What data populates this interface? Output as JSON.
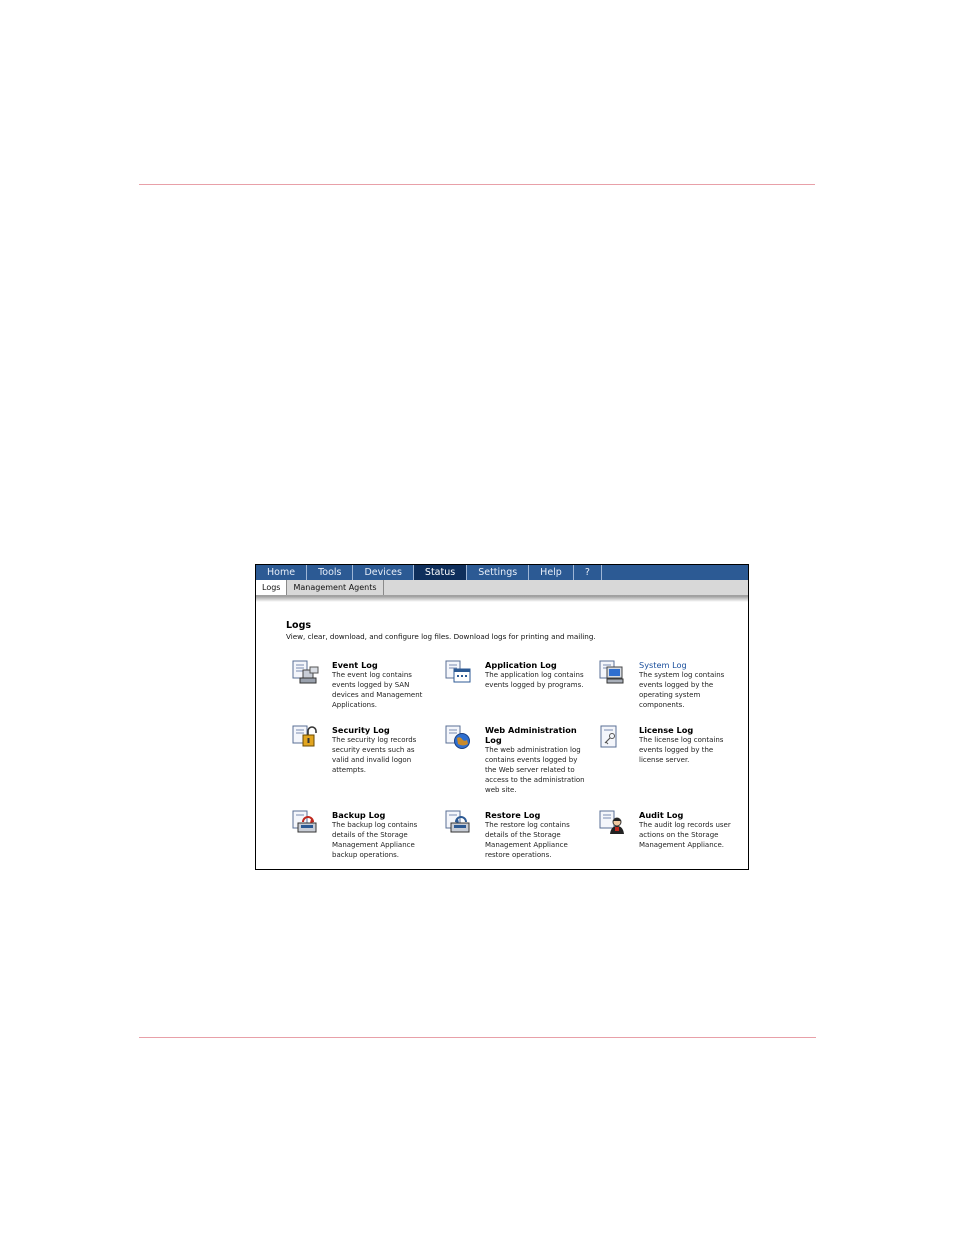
{
  "nav": {
    "tabs": [
      {
        "label": "Home"
      },
      {
        "label": "Tools"
      },
      {
        "label": "Devices"
      },
      {
        "label": "Status"
      },
      {
        "label": "Settings"
      },
      {
        "label": "Help"
      },
      {
        "label": "?"
      }
    ],
    "active": "Status"
  },
  "subnav": {
    "tabs": [
      {
        "label": "Logs"
      },
      {
        "label": "Management Agents"
      }
    ],
    "active": "Logs"
  },
  "page": {
    "title": "Logs",
    "description": "View, clear, download, and configure log files. Download logs for printing and mailing."
  },
  "logs": [
    {
      "name": "Event Log",
      "description": "The event log contains events logged by SAN devices and Management Applications.",
      "icon": "event-log-icon"
    },
    {
      "name": "Application Log",
      "description": "The application log contains events logged by programs.",
      "icon": "application-log-icon"
    },
    {
      "name": "System Log",
      "description": "The system log contains events logged by the operating system components.",
      "icon": "system-log-icon"
    },
    {
      "name": "Security Log",
      "description": "The security log records security events such as valid and invalid logon attempts.",
      "icon": "security-log-icon"
    },
    {
      "name": "Web Administration Log",
      "description": "The web administration log contains events logged by the Web server related to access to the administration web site.",
      "icon": "web-administration-log-icon"
    },
    {
      "name": "License Log",
      "description": "The license log contains events logged by the license server.",
      "icon": "license-log-icon"
    },
    {
      "name": "Backup Log",
      "description": "The backup log contains details of the Storage Management Appliance backup operations.",
      "icon": "backup-log-icon"
    },
    {
      "name": "Restore Log",
      "description": "The restore log contains details of the Storage Management Appliance restore operations.",
      "icon": "restore-log-icon"
    },
    {
      "name": "Audit Log",
      "description": "The audit log records user actions on the Storage Management Appliance.",
      "icon": "audit-log-icon"
    }
  ],
  "colors": {
    "nav_bg": "#2c5a94",
    "nav_active": "#0f2f5c",
    "link": "#1a4f9c",
    "rule": "#e8a0a8"
  }
}
